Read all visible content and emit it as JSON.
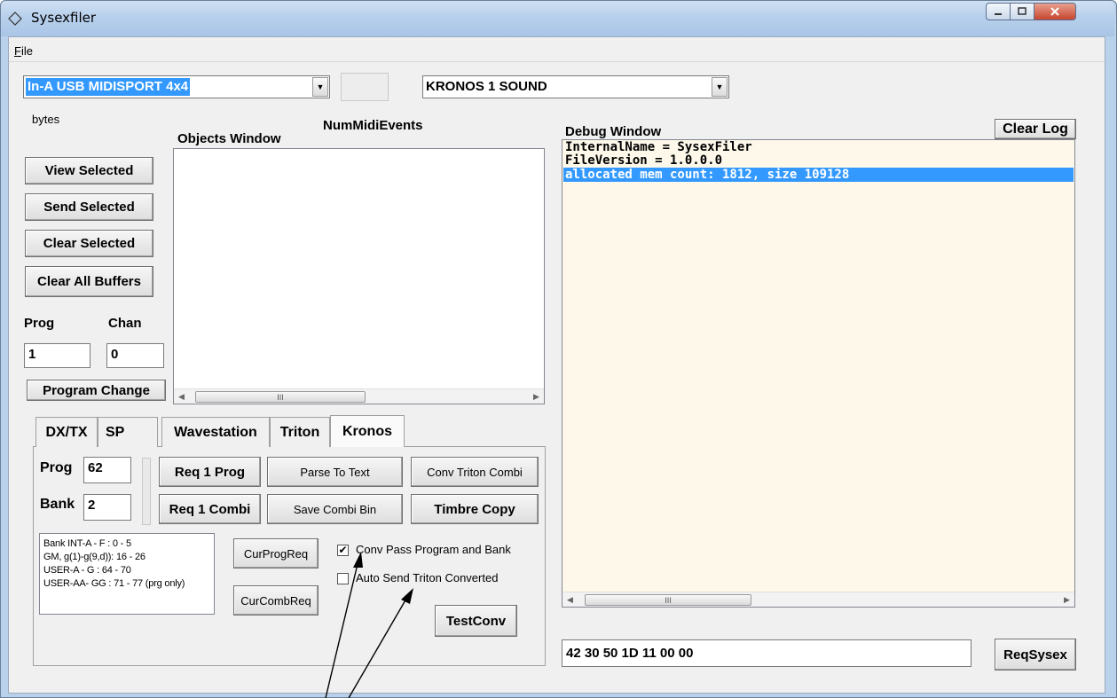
{
  "window": {
    "title": "Sysexfiler"
  },
  "menu": {
    "file_accel": "F",
    "file_rest": "ile"
  },
  "top": {
    "midi_in": "In-A USB MIDISPORT 4x4",
    "sound_select": "KRONOS 1 SOUND"
  },
  "left": {
    "bytes_label": "bytes",
    "num_midi_events": "NumMidiEvents",
    "objects_window_label": "Objects Window",
    "buttons": {
      "view_selected": "View Selected",
      "send_selected": "Send Selected",
      "clear_selected": "Clear Selected",
      "clear_all_buffers": "Clear All Buffers",
      "program_change": "Program Change"
    },
    "prog_label": "Prog",
    "chan_label": "Chan",
    "prog_value": "1",
    "chan_value": "0"
  },
  "tabs": [
    "DX/TX",
    "SP",
    "Wavestation",
    "Triton",
    "Kronos"
  ],
  "kronos": {
    "prog_label": "Prog",
    "bank_label": "Bank",
    "prog_value": "62",
    "bank_value": "2",
    "req_1_prog": "Req 1 Prog",
    "req_1_combi": "Req 1 Combi",
    "parse_to_text": "Parse To Text",
    "save_combi_bin": "Save Combi Bin",
    "conv_triton_combi": "Conv Triton Combi",
    "timbre_copy": "Timbre Copy",
    "bank_info": [
      "Bank INT-A - F  : 0  -  5",
      "GM, g(1)-g(9,d)): 16 - 26",
      "USER-A - G     : 64 - 70",
      "USER-AA- GG : 71 - 77 (prg only)"
    ],
    "cur_prog_req": "CurProgReq",
    "cur_comb_req": "CurCombReq",
    "conv_pass_label": "Conv Pass Program and Bank",
    "conv_pass_checked": true,
    "auto_send_label": "Auto Send Triton Converted",
    "auto_send_checked": false,
    "test_conv": "TestConv"
  },
  "debug": {
    "label": "Debug Window",
    "clear_log": "Clear Log",
    "lines": [
      "InternalName = SysexFiler",
      "FileVersion = 1.0.0.0",
      "allocated mem count: 1812, size 109128"
    ],
    "sysex_input": "42 30 50 1D 11 00 00",
    "req_sysex": "ReqSysex"
  },
  "scrollbar_thumb_glyph": "III"
}
